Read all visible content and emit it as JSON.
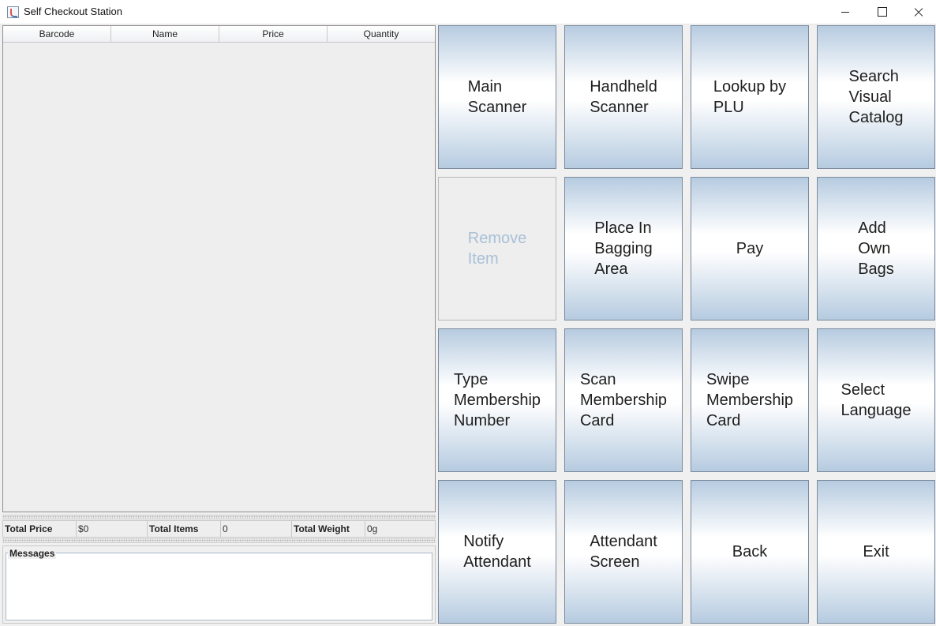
{
  "window": {
    "title": "Self Checkout Station"
  },
  "cart_table": {
    "columns": [
      "Barcode",
      "Name",
      "Price",
      "Quantity"
    ],
    "rows": []
  },
  "totals": {
    "price_label": "Total Price",
    "price_value": "$0",
    "items_label": "Total Items",
    "items_value": "0",
    "weight_label": "Total Weight",
    "weight_value": "0g"
  },
  "messages": {
    "title": "Messages",
    "text": ""
  },
  "buttons": {
    "main_scanner": "Main\nScanner",
    "handheld_scanner": "Handheld\nScanner",
    "lookup_plu": "Lookup by\nPLU",
    "search_visual_catalog": "Search\nVisual\nCatalog",
    "remove_item": "Remove\nItem",
    "place_in_bagging_area": "Place In\nBagging\nArea",
    "pay": "Pay",
    "add_own_bags": "Add\nOwn\nBags",
    "type_membership_number": "Type\nMembership\nNumber",
    "scan_membership_card": "Scan\nMembership\nCard",
    "swipe_membership_card": "Swipe\nMembership\nCard",
    "select_language": "Select\nLanguage",
    "notify_attendant": "Notify\nAttendant",
    "attendant_screen": "Attendant\nScreen",
    "back": "Back",
    "exit": "Exit"
  },
  "states": {
    "remove_item_enabled": false
  },
  "colors": {
    "button_gradient_edge": "#b6cbe0",
    "button_gradient_center": "#ffffff",
    "disabled_text": "#a9c0d6"
  }
}
